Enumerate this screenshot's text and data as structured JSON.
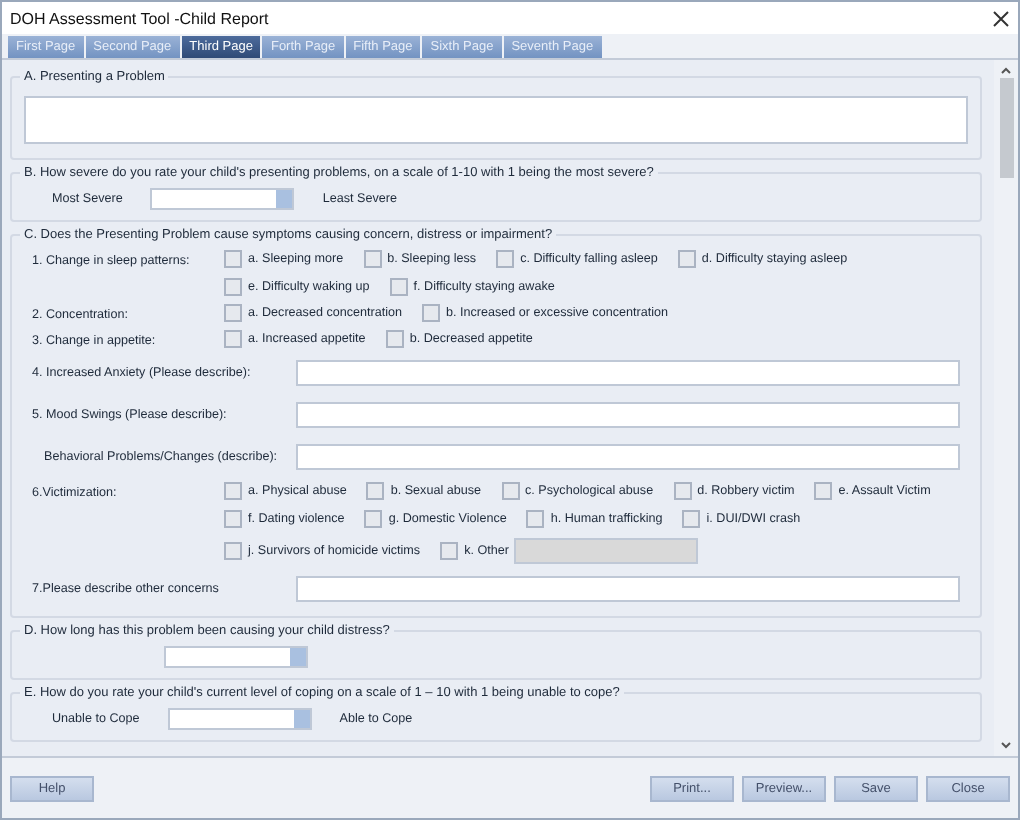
{
  "window": {
    "title": "DOH Assessment Tool -Child Report"
  },
  "tabs": [
    {
      "label": "First Page",
      "selected": false
    },
    {
      "label": "Second Page",
      "selected": false
    },
    {
      "label": "Third Page",
      "selected": true
    },
    {
      "label": "Forth Page",
      "selected": false
    },
    {
      "label": "Fifth Page",
      "selected": false
    },
    {
      "label": "Sixth Page",
      "selected": false
    },
    {
      "label": "Seventh Page",
      "selected": false
    }
  ],
  "sections": [
    {
      "kind": "text",
      "legend": "A. Presenting a Problem"
    },
    {
      "kind": "rating",
      "legend": "B. How severe do you rate your child's presenting problems, on a scale of 1-10 with 1 being the most severe?",
      "low_label": "Most Severe",
      "high_label": "Least Severe"
    },
    {
      "kind": "symptoms",
      "legend": "C. Does the Presenting Problem cause symptoms causing concern, distress or impairment?",
      "items": [
        {
          "kind": "checks",
          "label": "1. Change in sleep patterns:",
          "rows": [
            [
              {
                "label": "a. Sleeping more",
                "checked": false
              },
              {
                "label": "b. Sleeping less",
                "checked": false
              },
              {
                "label": "c. Difficulty falling asleep",
                "checked": false
              },
              {
                "label": "d. Difficulty staying asleep",
                "checked": false
              }
            ],
            [
              {
                "label": "e. Difficulty waking up",
                "checked": false
              },
              {
                "label": "f. Difficulty staying awake",
                "checked": false
              }
            ]
          ]
        },
        {
          "kind": "checks",
          "label": "2. Concentration:",
          "rows": [
            [
              {
                "label": "a. Decreased concentration",
                "checked": false
              },
              {
                "label": "b. Increased or excessive concentration",
                "checked": false
              }
            ]
          ]
        },
        {
          "kind": "checks",
          "label": "3. Change in appetite:",
          "rows": [
            [
              {
                "label": "a.  Increased appetite",
                "checked": false
              },
              {
                "label": "b. Decreased appetite",
                "checked": false
              }
            ]
          ]
        },
        {
          "kind": "text",
          "label": "4. Increased Anxiety (Please describe):"
        },
        {
          "kind": "text",
          "label": "5. Mood Swings (Please describe):"
        },
        {
          "kind": "text",
          "label": "Behavioral Problems/Changes (describe):",
          "indent": true
        },
        {
          "kind": "checks",
          "label": "6.Victimization:",
          "rows": [
            [
              {
                "label": "a. Physical abuse",
                "checked": false
              },
              {
                "label": "b. Sexual abuse",
                "checked": false
              },
              {
                "label": "c. Psychological abuse",
                "checked": false
              },
              {
                "label": "d. Robbery victim",
                "checked": false
              },
              {
                "label": "e. Assault Victim",
                "checked": false
              }
            ],
            [
              {
                "label": "f. Dating violence",
                "checked": false
              },
              {
                "label": "g. Domestic Violence",
                "checked": false
              },
              {
                "label": "h. Human trafficking",
                "checked": false
              },
              {
                "label": "i. DUI/DWI crash",
                "checked": false
              }
            ],
            [
              {
                "label": "j. Survivors of homicide victims",
                "checked": false
              },
              {
                "label": "k. Other",
                "checked": false,
                "field": {
                  "disabled": true
                }
              }
            ]
          ]
        },
        {
          "kind": "text",
          "label": "7.Please describe other concerns"
        }
      ]
    },
    {
      "kind": "duration",
      "legend": "D. How long has this problem been causing your child distress?"
    },
    {
      "kind": "rating",
      "legend": "E. How do you rate your child's current level of coping on a scale of 1 – 10 with 1 being unable to cope?",
      "low_label": "Unable to Cope",
      "high_label": "Able to Cope"
    }
  ],
  "help_button": {
    "label": "Help"
  },
  "buttons": [
    {
      "label": "Print..."
    },
    {
      "label": "Preview..."
    },
    {
      "label": "Save"
    },
    {
      "label": "Close"
    }
  ]
}
